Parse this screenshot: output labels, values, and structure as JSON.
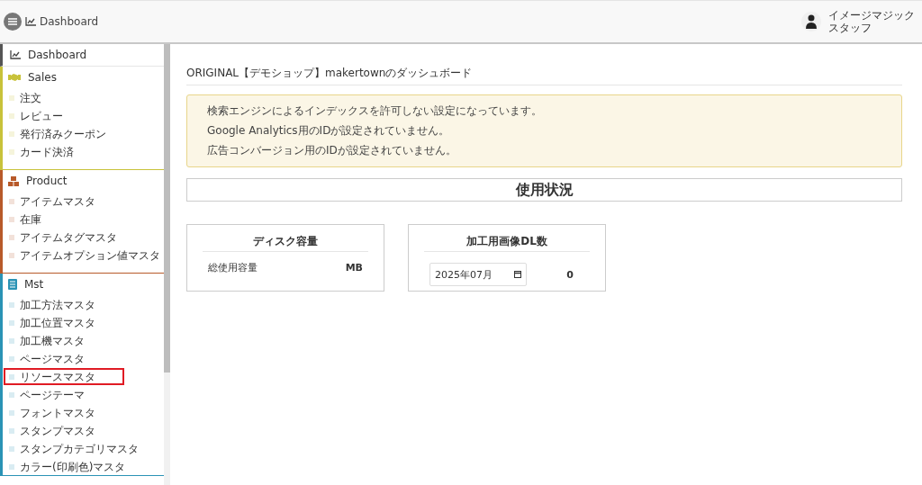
{
  "header": {
    "title": "Dashboard",
    "user_lines": [
      "イメージマジック",
      "スタッフ"
    ]
  },
  "sidebar": {
    "top": {
      "label": "Dashboard"
    },
    "sections": [
      {
        "title": "Sales",
        "kind": "handshake",
        "color": "#c8c23a",
        "items": [
          {
            "label": "注文",
            "highlighted": false
          },
          {
            "label": "レビュー",
            "highlighted": false
          },
          {
            "label": "発行済みクーポン",
            "highlighted": false
          },
          {
            "label": "カード決済",
            "highlighted": false
          }
        ]
      },
      {
        "title": "Product",
        "kind": "boxes",
        "color": "#b85a2a",
        "items": [
          {
            "label": "アイテムマスタ",
            "highlighted": false
          },
          {
            "label": "在庫",
            "highlighted": false
          },
          {
            "label": "アイテムタグマスタ",
            "highlighted": false
          },
          {
            "label": "アイテムオプション値マスタ",
            "highlighted": false
          }
        ]
      },
      {
        "title": "Mst",
        "kind": "book",
        "color": "#2a93b5",
        "items": [
          {
            "label": "加工方法マスタ",
            "highlighted": false
          },
          {
            "label": "加工位置マスタ",
            "highlighted": false
          },
          {
            "label": "加工機マスタ",
            "highlighted": false
          },
          {
            "label": "ページマスタ",
            "highlighted": false
          },
          {
            "label": "リソースマスタ",
            "highlighted": true
          },
          {
            "label": "ページテーマ",
            "highlighted": false
          },
          {
            "label": "フォントマスタ",
            "highlighted": false
          },
          {
            "label": "スタンプマスタ",
            "highlighted": false
          },
          {
            "label": "スタンプカテゴリマスタ",
            "highlighted": false
          },
          {
            "label": "カラー(印刷色)マスタ",
            "highlighted": false
          }
        ]
      }
    ]
  },
  "main": {
    "title": "ORIGINAL【デモショップ】makertownのダッシュボード",
    "alerts": [
      "検索エンジンによるインデックスを許可しない設定になっています。",
      "Google Analytics用のIDが設定されていません。",
      "広告コンバージョン用のIDが設定されていません。"
    ],
    "usage_heading": "使用状況",
    "disk": {
      "title": "ディスク容量",
      "label": "総使用容量",
      "value": "MB"
    },
    "downloads": {
      "title": "加工用画像DL数",
      "month": "2025年07月",
      "value": "0"
    }
  }
}
